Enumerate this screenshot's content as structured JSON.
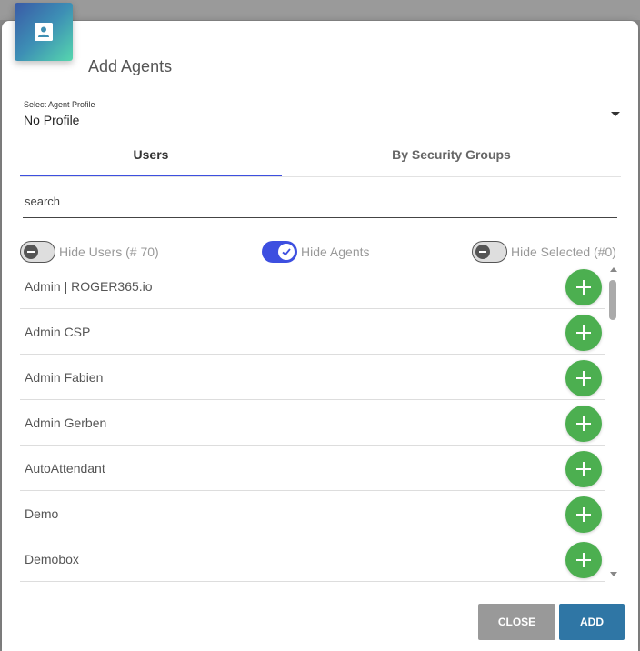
{
  "dialog": {
    "title": "Add Agents",
    "icon": "contact-card-icon",
    "accent_color": "#3d4fe0"
  },
  "profile": {
    "label": "Select Agent Profile",
    "value": "No Profile"
  },
  "tabs": [
    {
      "label": "Users",
      "active": true
    },
    {
      "label": "By Security Groups",
      "active": false
    }
  ],
  "search": {
    "placeholder": "search",
    "value": ""
  },
  "toggles": [
    {
      "label": "Hide Users (# 70)",
      "on": false
    },
    {
      "label": "Hide Agents",
      "on": true
    },
    {
      "label": "Hide Selected (#0)",
      "on": false
    }
  ],
  "users": [
    {
      "name": "Admin | ROGER365.io"
    },
    {
      "name": "Admin CSP"
    },
    {
      "name": "Admin Fabien"
    },
    {
      "name": "Admin Gerben"
    },
    {
      "name": "AutoAttendant"
    },
    {
      "name": "Demo"
    },
    {
      "name": "Demobox"
    }
  ],
  "add_icon": "plus-icon",
  "add_color": "#4caf50",
  "buttons": {
    "close_label": "CLOSE",
    "add_label": "ADD"
  }
}
